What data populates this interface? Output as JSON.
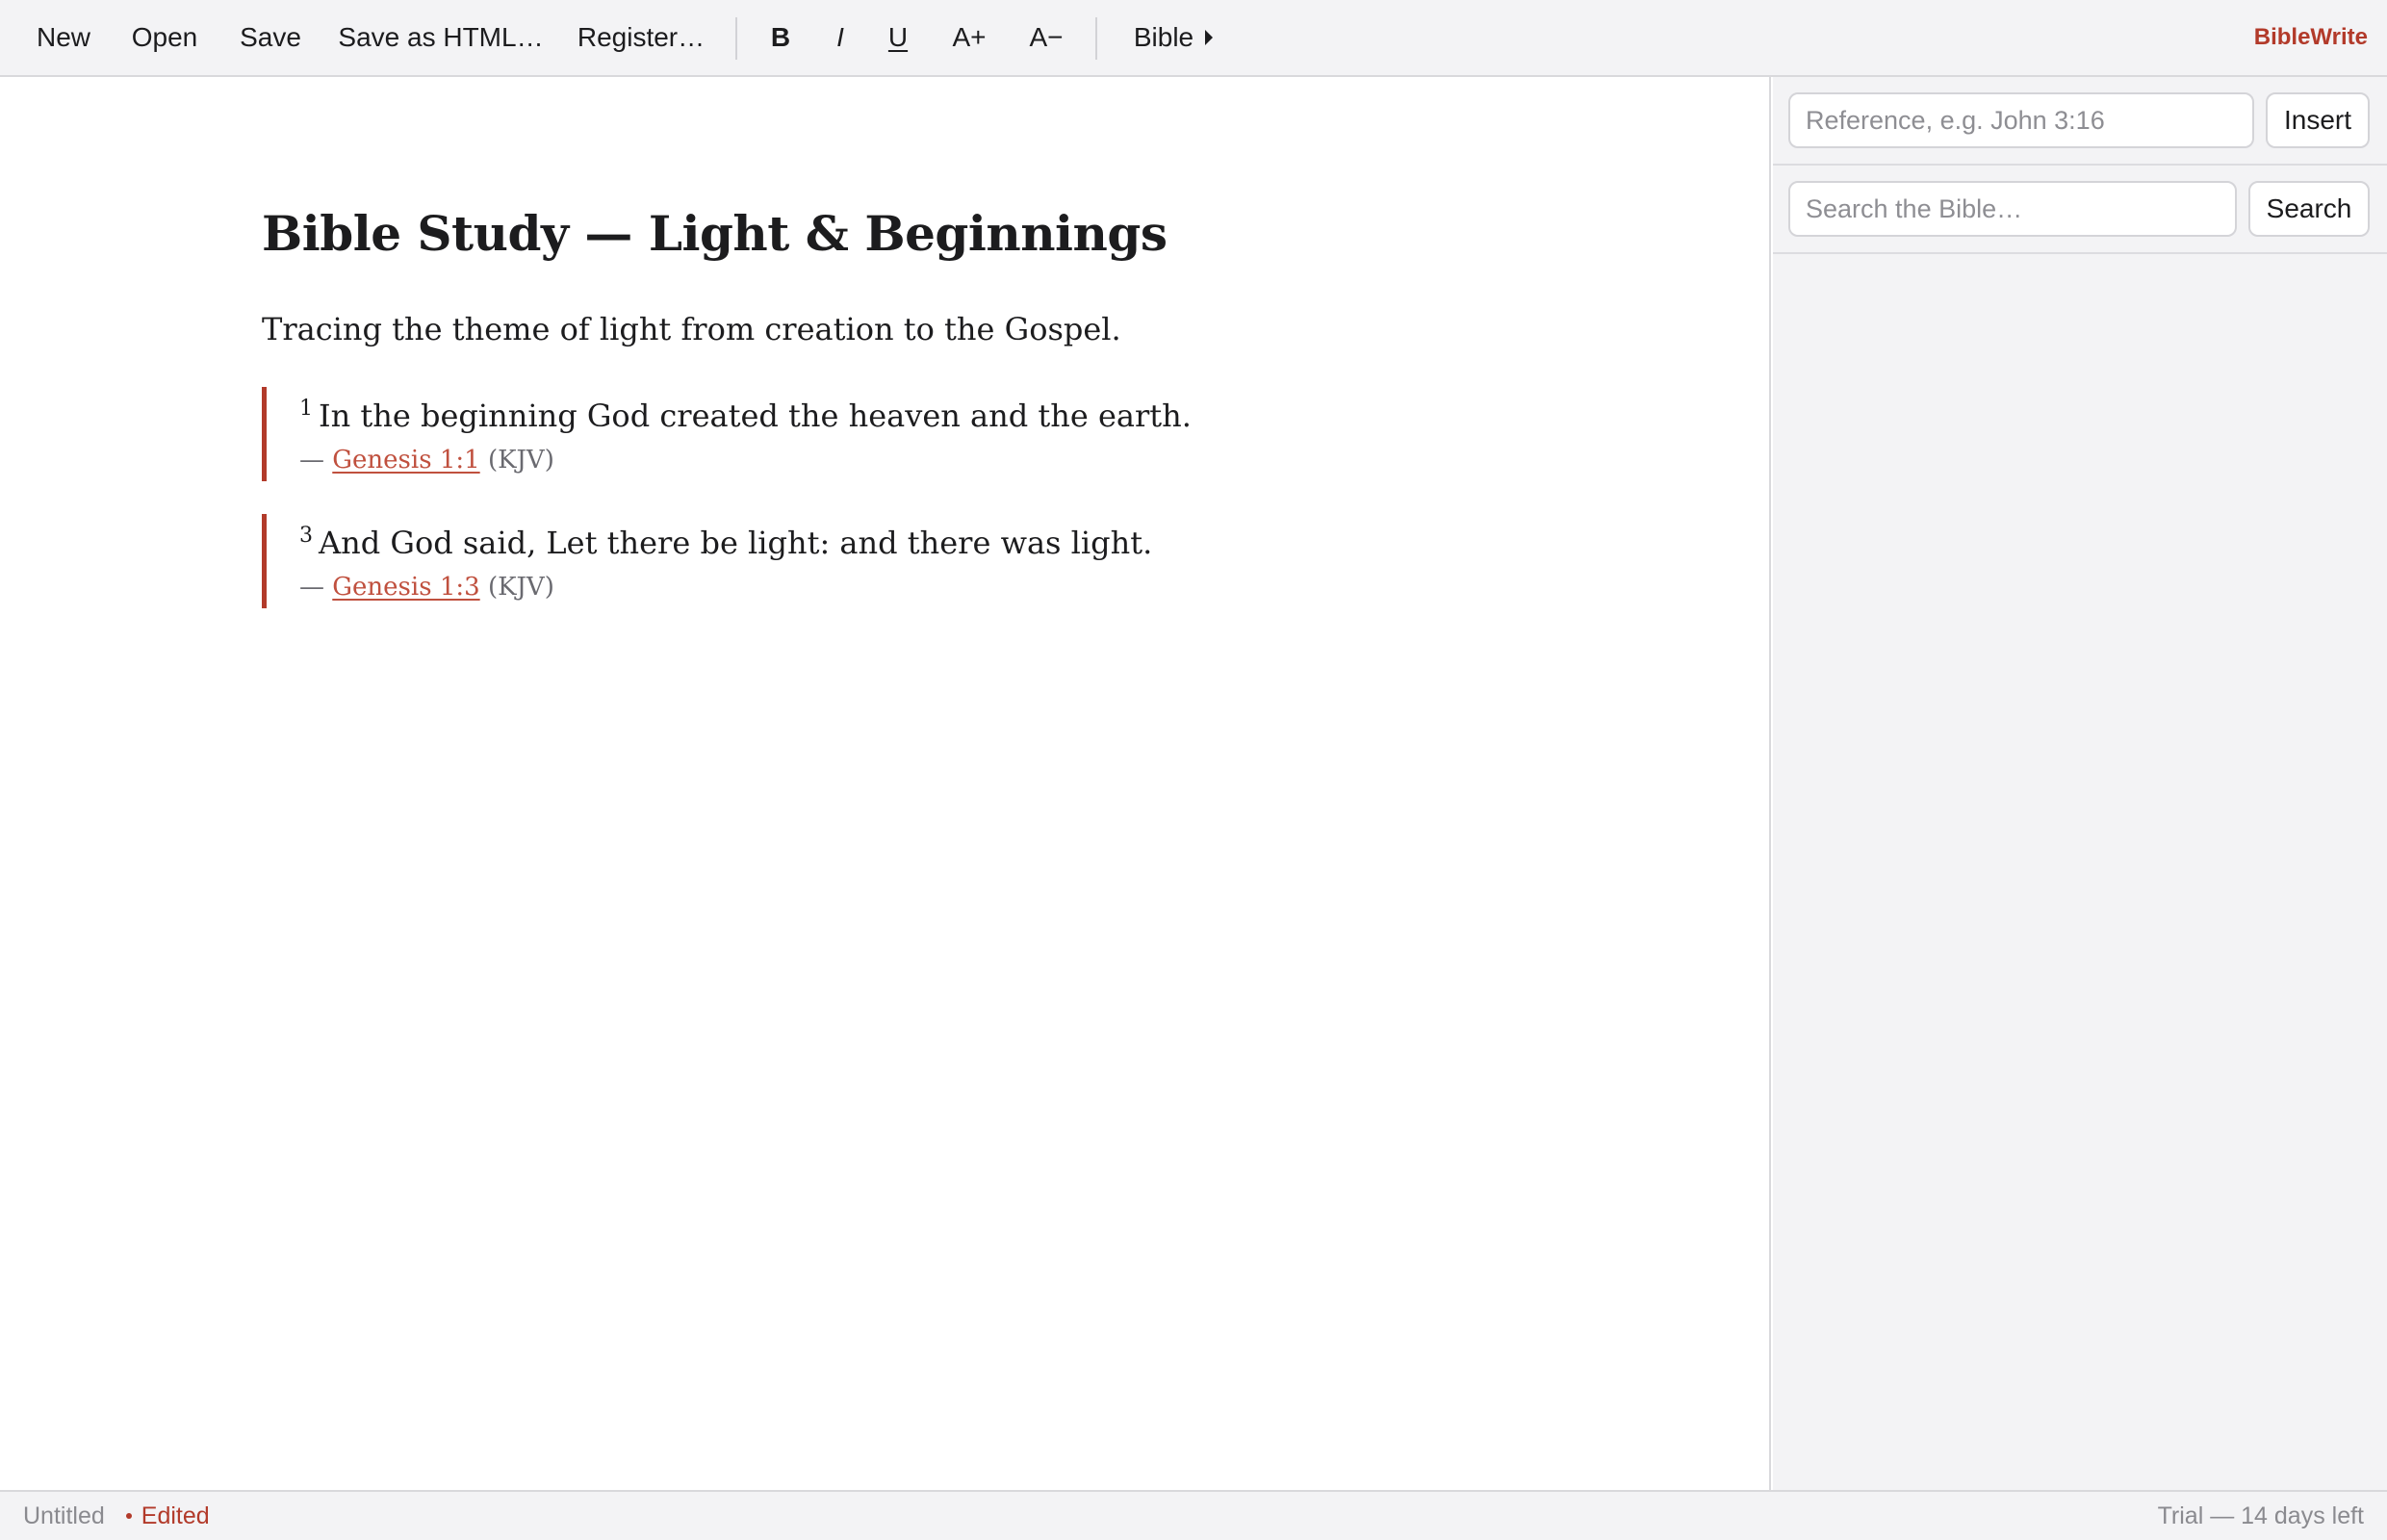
{
  "toolbar": {
    "new_label": "New",
    "open_label": "Open",
    "save_label": "Save",
    "save_html_label": "Save as HTML…",
    "register_label": "Register…",
    "bold_label": "B",
    "italic_label": "I",
    "underline_label": "U",
    "font_larger_label": "A+",
    "font_smaller_label": "A−",
    "bible_menu_label": "Bible",
    "bible_menu_icon": "caret-right-icon"
  },
  "brand": {
    "name": "BibleWrite",
    "color": "#b23a2a"
  },
  "document": {
    "title": "Bible Study — Light & Beginnings",
    "intro": "Tracing the theme of light from creation to the Gospel.",
    "quotes": [
      {
        "verse_number": "1",
        "text": "In the beginning God created the heaven and the earth.",
        "dash": "—",
        "reference": "Genesis 1:1",
        "version": "(KJV)"
      },
      {
        "verse_number": "3",
        "text": "And God said, Let there be light: and there was light.",
        "dash": "—",
        "reference": "Genesis 1:3",
        "version": "(KJV)"
      }
    ]
  },
  "panel": {
    "reference_placeholder": "Reference, e.g. John 3:16",
    "reference_value": "",
    "insert_label": "Insert",
    "search_placeholder": "Search the Bible…",
    "search_value": "",
    "search_label": "Search"
  },
  "status": {
    "filename": "Untitled",
    "edited": "Edited",
    "trial": "Trial — 14 days left"
  },
  "colors": {
    "accent": "#b23a2a",
    "link": "#c0503e",
    "chrome_background": "#f3f3f5"
  }
}
